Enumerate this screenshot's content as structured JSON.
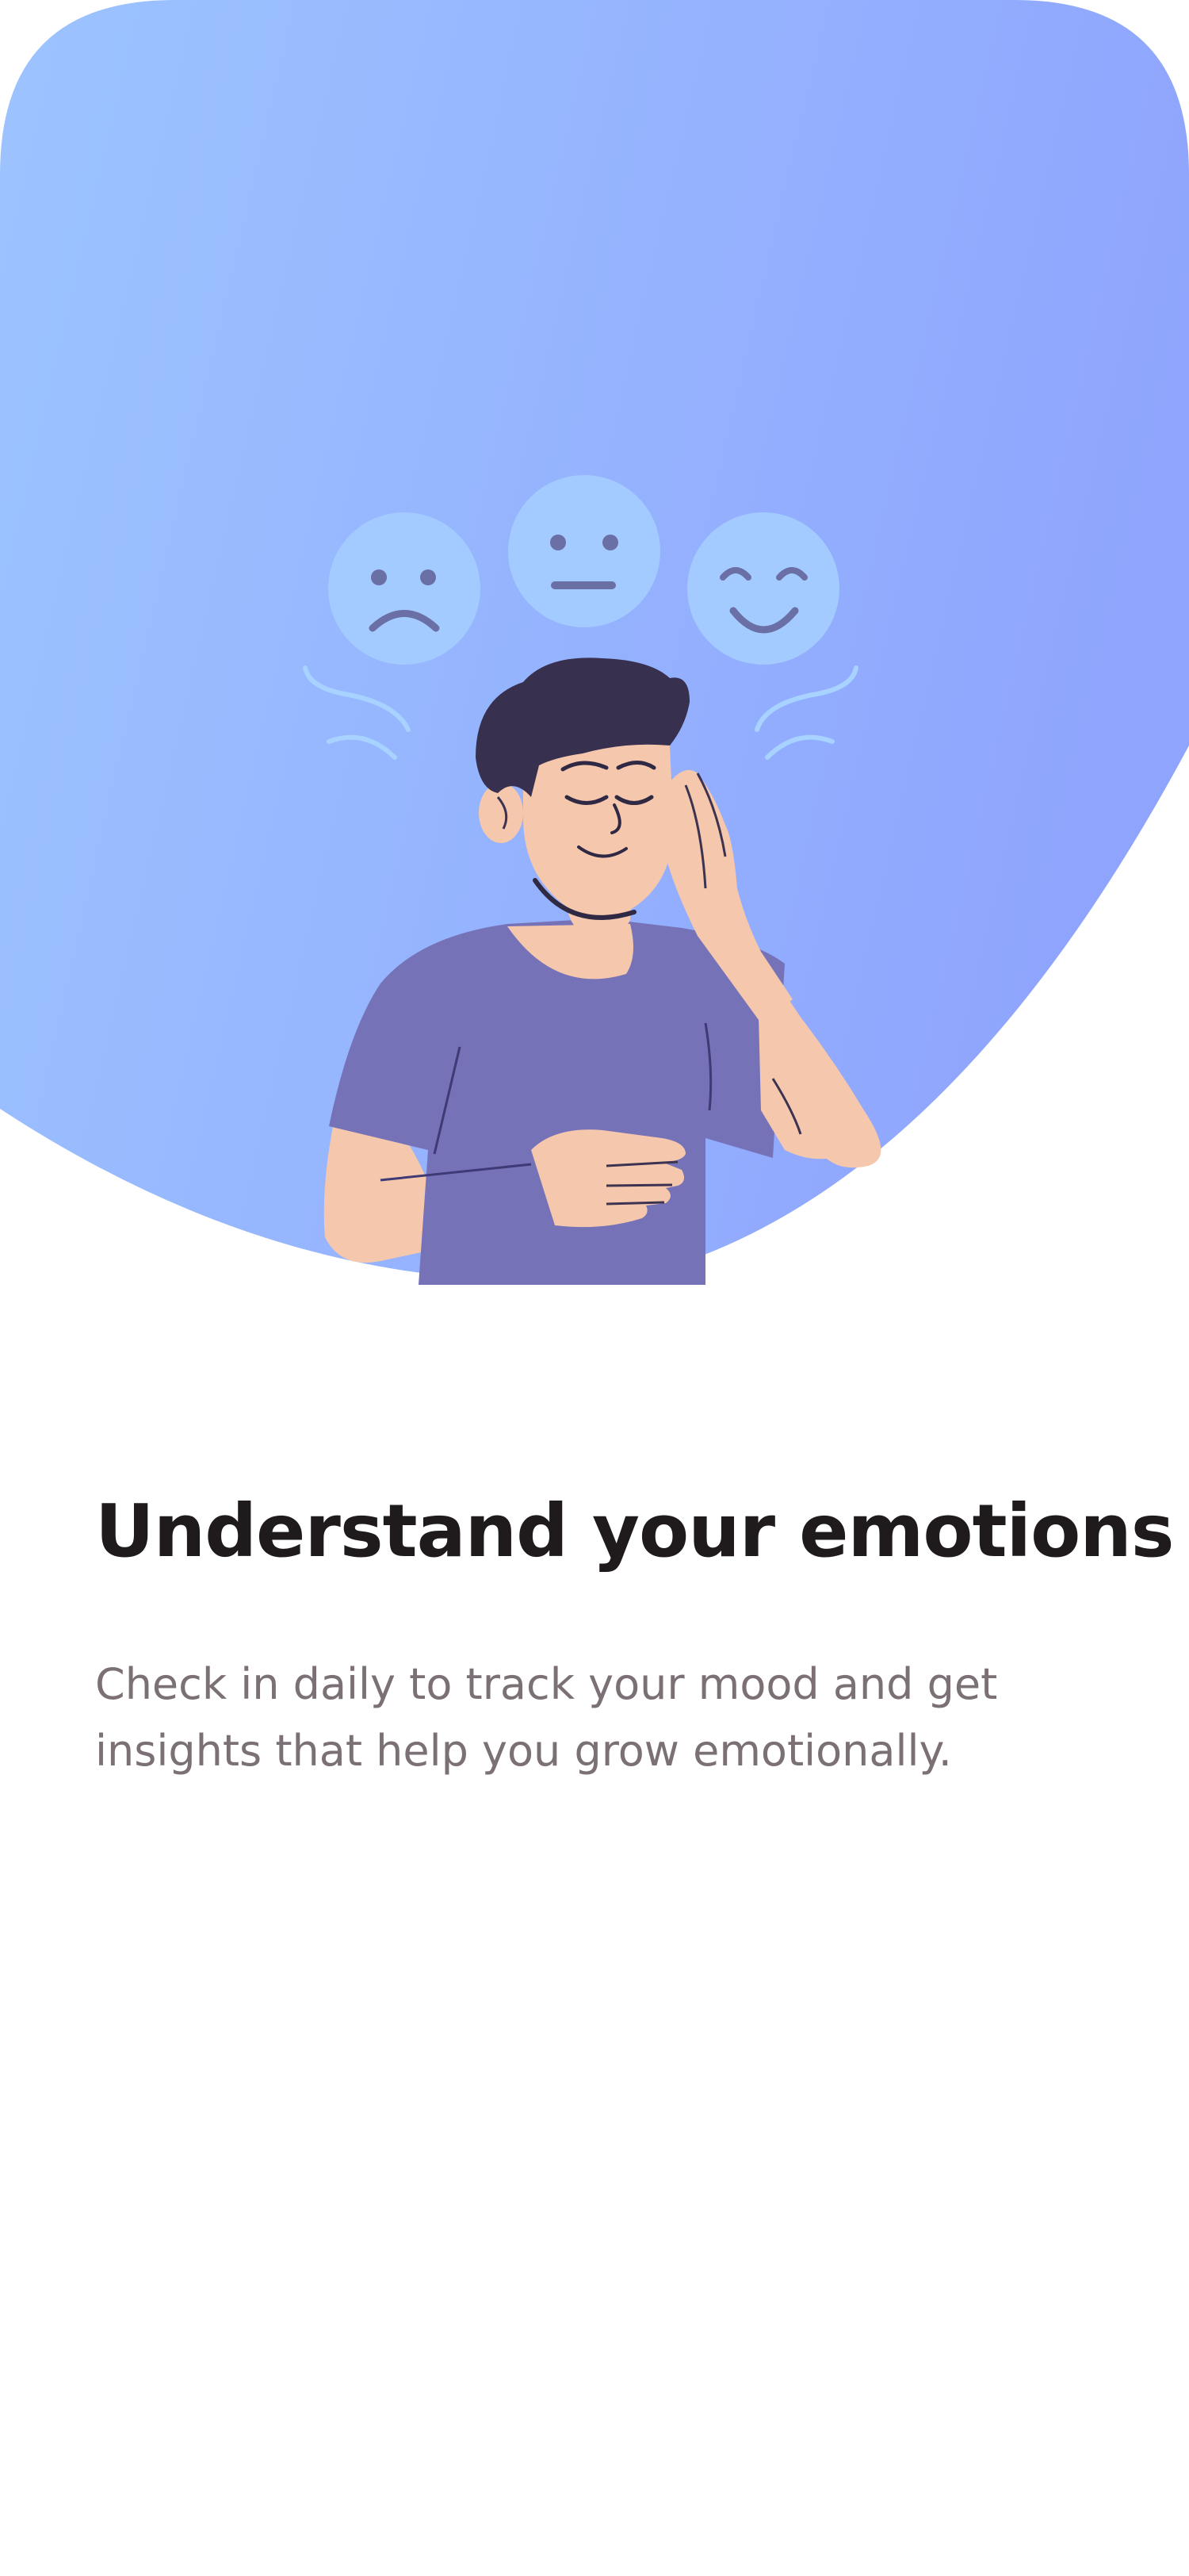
{
  "onboarding": {
    "title": "Understand your emotions",
    "description": "Check in daily to track your mood and get insights that help you grow emotionally."
  },
  "illustration": {
    "subject": "person-hand-on-head-eyes-closed",
    "moods": [
      "sad-face-icon",
      "neutral-face-icon",
      "happy-face-icon"
    ]
  },
  "colors": {
    "gradient_start": "#9cc4ff",
    "gradient_end": "#8fa5fd",
    "shirt": "#7672b8",
    "skin": "#f5c7ad",
    "hair": "#37304f",
    "face_bubble": "#a3cbff",
    "title": "#1f1a1c",
    "body_text": "#7a7075"
  }
}
